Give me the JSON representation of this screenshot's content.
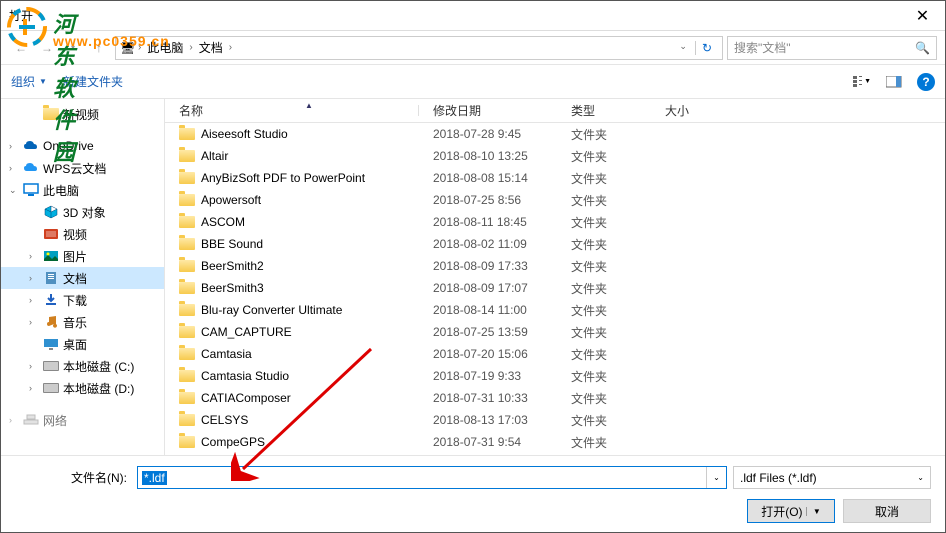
{
  "title": "打开",
  "breadcrumb": {
    "parts": [
      "此电脑",
      "文档"
    ],
    "sep": "›"
  },
  "search": {
    "placeholder": "搜索\"文档\""
  },
  "toolbar": {
    "organize": "组织",
    "newfolder": "新建文件夹"
  },
  "sidebar": [
    {
      "label": "新视频",
      "indent": true,
      "icon": "folder",
      "color": "#f7ca4d"
    },
    {
      "label": "OneDrive",
      "indent": false,
      "icon": "cloud",
      "color": "#0364b8",
      "chev": "›"
    },
    {
      "label": "WPS云文档",
      "indent": false,
      "icon": "cloud",
      "color": "#2196f3",
      "chev": "›"
    },
    {
      "label": "此电脑",
      "indent": false,
      "icon": "pc",
      "color": "#0078d7",
      "chev": "⌄",
      "bold": true
    },
    {
      "label": "3D 对象",
      "indent": true,
      "icon": "cube",
      "color": "#00b0e0"
    },
    {
      "label": "视频",
      "indent": true,
      "icon": "video",
      "color": "#d04020"
    },
    {
      "label": "图片",
      "indent": true,
      "icon": "image",
      "color": "#00a0c0",
      "chev": "›"
    },
    {
      "label": "文档",
      "indent": true,
      "icon": "doc",
      "color": "#5090c0",
      "chev": "›",
      "selected": true
    },
    {
      "label": "下载",
      "indent": true,
      "icon": "download",
      "color": "#2060c0",
      "chev": "›"
    },
    {
      "label": "音乐",
      "indent": true,
      "icon": "music",
      "color": "#d08020",
      "chev": "›"
    },
    {
      "label": "桌面",
      "indent": true,
      "icon": "desktop",
      "color": "#3090d0"
    },
    {
      "label": "本地磁盘 (C:)",
      "indent": true,
      "icon": "drive",
      "color": "#888",
      "chev": "›"
    },
    {
      "label": "本地磁盘 (D:)",
      "indent": true,
      "icon": "drive",
      "color": "#888",
      "chev": "›"
    },
    {
      "label": "网络",
      "indent": false,
      "icon": "net",
      "color": "#888",
      "chev": "›",
      "faded": true
    }
  ],
  "columns": {
    "name": "名称",
    "date": "修改日期",
    "type": "类型",
    "size": "大小"
  },
  "files": [
    {
      "name": "Aiseesoft Studio",
      "date": "2018-07-28 9:45",
      "type": "文件夹"
    },
    {
      "name": "Altair",
      "date": "2018-08-10 13:25",
      "type": "文件夹"
    },
    {
      "name": "AnyBizSoft PDF to PowerPoint",
      "date": "2018-08-08 15:14",
      "type": "文件夹"
    },
    {
      "name": "Apowersoft",
      "date": "2018-07-25 8:56",
      "type": "文件夹"
    },
    {
      "name": "ASCOM",
      "date": "2018-08-11 18:45",
      "type": "文件夹"
    },
    {
      "name": "BBE Sound",
      "date": "2018-08-02 11:09",
      "type": "文件夹"
    },
    {
      "name": "BeerSmith2",
      "date": "2018-08-09 17:33",
      "type": "文件夹"
    },
    {
      "name": "BeerSmith3",
      "date": "2018-08-09 17:07",
      "type": "文件夹"
    },
    {
      "name": "Blu-ray Converter Ultimate",
      "date": "2018-08-14 11:00",
      "type": "文件夹"
    },
    {
      "name": "CAM_CAPTURE",
      "date": "2018-07-25 13:59",
      "type": "文件夹"
    },
    {
      "name": "Camtasia",
      "date": "2018-07-20 15:06",
      "type": "文件夹"
    },
    {
      "name": "Camtasia Studio",
      "date": "2018-07-19 9:33",
      "type": "文件夹"
    },
    {
      "name": "CATIAComposer",
      "date": "2018-07-31 10:33",
      "type": "文件夹"
    },
    {
      "name": "CELSYS",
      "date": "2018-08-13 17:03",
      "type": "文件夹"
    },
    {
      "name": "CompeGPS",
      "date": "2018-07-31 9:54",
      "type": "文件夹"
    }
  ],
  "footer": {
    "filelabel": "文件名(N):",
    "filevalue": "*.ldf",
    "filter": ".ldf Files (*.ldf)",
    "open": "打开(O)",
    "cancel": "取消"
  },
  "watermark": {
    "text": "河东软件园",
    "url": "www.pc0359.cn"
  }
}
